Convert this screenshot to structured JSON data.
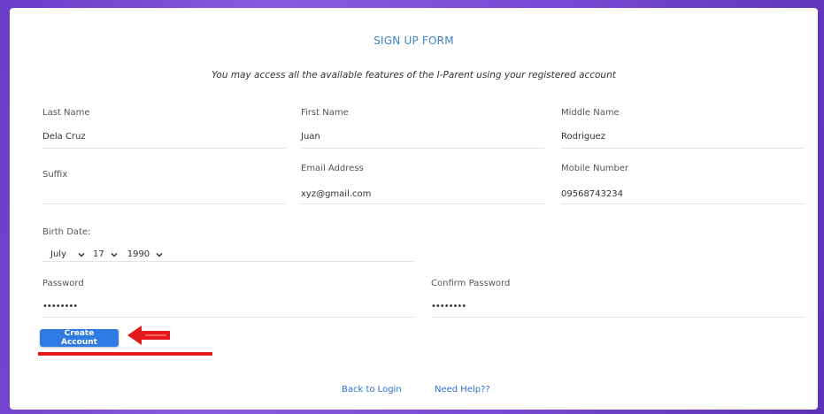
{
  "form": {
    "title": "SIGN UP FORM",
    "subtitle": "You may access all the available features of the I-Parent using your registered account"
  },
  "fields": {
    "last_name": {
      "label": "Last Name",
      "value": "Dela Cruz"
    },
    "first_name": {
      "label": "First Name",
      "value": "Juan"
    },
    "middle_name": {
      "label": "Middle Name",
      "value": "Rodriguez"
    },
    "suffix": {
      "label": "Suffix",
      "value": ""
    },
    "email": {
      "label": "Email Address",
      "value": "xyz@gmail.com"
    },
    "mobile": {
      "label": "Mobile Number",
      "value": "09568743234"
    },
    "password": {
      "label": "Password",
      "value": "••••••••"
    },
    "confirm_password": {
      "label": "Confirm Password",
      "value": "••••••••"
    }
  },
  "birth_date": {
    "label": "Birth Date:",
    "month": "July",
    "day": "17",
    "year": "1990"
  },
  "actions": {
    "create_account": "Create Account",
    "back_to_login": "Back to Login",
    "need_help": "Need Help??"
  },
  "colors": {
    "accent": "#2f7be3",
    "annotation": "#e3191a",
    "background": "#7a4ad6"
  }
}
